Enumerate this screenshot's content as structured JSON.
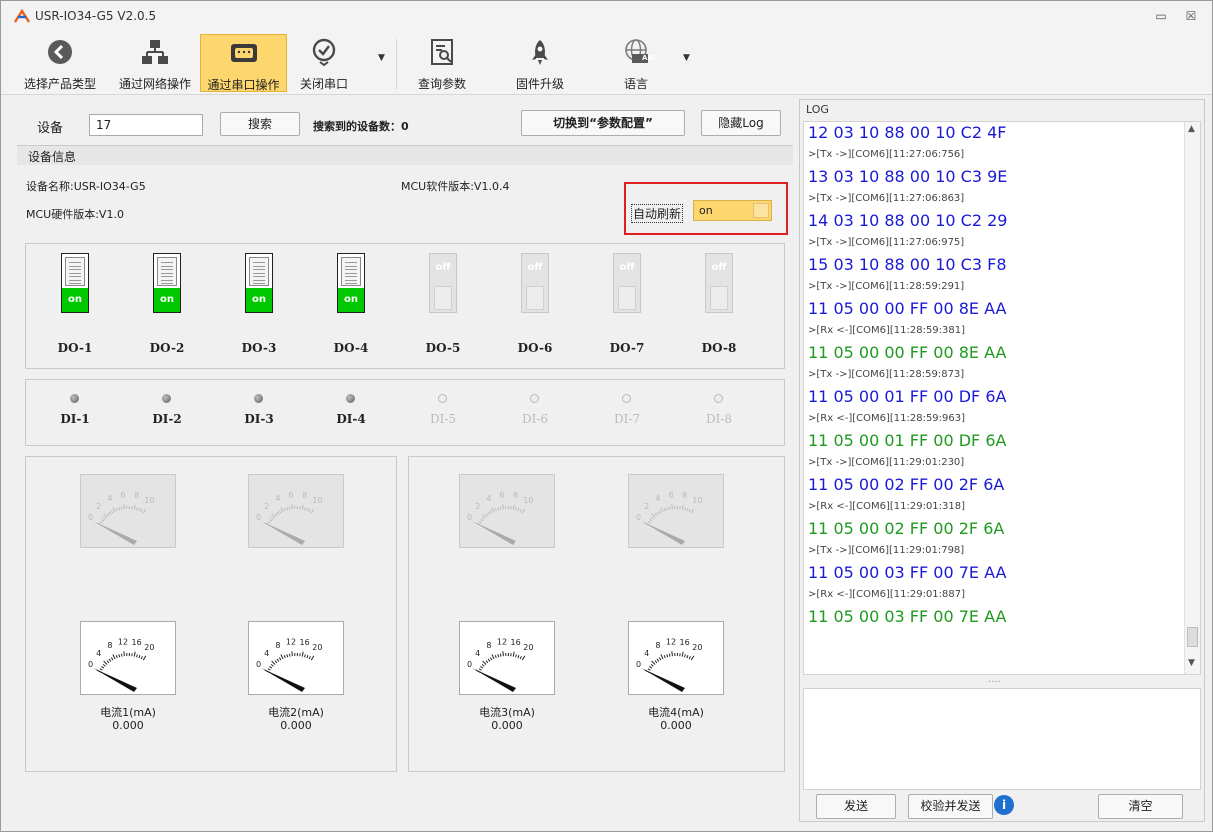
{
  "window": {
    "title": "USR-IO34-G5 V2.0.5",
    "minimize": "▭",
    "close": "☒"
  },
  "toolbar": {
    "items": [
      {
        "label": "选择产品类型"
      },
      {
        "label": "通过网络操作"
      },
      {
        "label": "通过串口操作"
      },
      {
        "label": "关闭串口"
      },
      {
        "label": "查询参数"
      },
      {
        "label": "固件升级"
      },
      {
        "label": "语言"
      }
    ],
    "lang_badge": "ABC"
  },
  "search": {
    "device_label": "设备",
    "device_value": "17",
    "search_button": "搜索",
    "found_text": "搜索到的设备数：0",
    "switch_button": "切换到“参数配置”",
    "hide_log_button": "隐藏Log"
  },
  "device_info": {
    "group_title": "设备信息",
    "device_name": "设备名称:USR-IO34-G5",
    "mcu_sw": "MCU软件版本:V1.0.4",
    "mcu_hw": "MCU硬件版本:V1.0",
    "auto_refresh_label": "自动刷新",
    "auto_refresh_value": "on"
  },
  "do": [
    {
      "label": "DO-1",
      "state": "on"
    },
    {
      "label": "DO-2",
      "state": "on"
    },
    {
      "label": "DO-3",
      "state": "on"
    },
    {
      "label": "DO-4",
      "state": "on"
    },
    {
      "label": "DO-5",
      "state": "off"
    },
    {
      "label": "DO-6",
      "state": "off"
    },
    {
      "label": "DO-7",
      "state": "off"
    },
    {
      "label": "DO-8",
      "state": "off"
    }
  ],
  "di": [
    {
      "label": "DI-1",
      "active": true
    },
    {
      "label": "DI-2",
      "active": true
    },
    {
      "label": "DI-3",
      "active": true
    },
    {
      "label": "DI-4",
      "active": true
    },
    {
      "label": "DI-5",
      "active": false
    },
    {
      "label": "DI-6",
      "active": false
    },
    {
      "label": "DI-7",
      "active": false
    },
    {
      "label": "DI-8",
      "active": false
    }
  ],
  "gauges_top": {
    "ticks": [
      "0",
      "2",
      "4",
      "6",
      "8",
      "10"
    ]
  },
  "gauges_current": {
    "ticks": [
      "0",
      "4",
      "8",
      "12",
      "16",
      "20"
    ],
    "items": [
      {
        "name": "电流1(mA)",
        "value": "0.000"
      },
      {
        "name": "电流2(mA)",
        "value": "0.000"
      },
      {
        "name": "电流3(mA)",
        "value": "0.000"
      },
      {
        "name": "电流4(mA)",
        "value": "0.000"
      }
    ]
  },
  "log": {
    "title": "LOG",
    "lines": [
      {
        "text": "12 03 10 88 00 10 C2 4F",
        "kind": "tx"
      },
      {
        "text": ">[Tx ->][COM6][11:27:06:756]",
        "kind": "meta"
      },
      {
        "text": "13 03 10 88 00 10 C3 9E",
        "kind": "tx"
      },
      {
        "text": ">[Tx ->][COM6][11:27:06:863]",
        "kind": "meta"
      },
      {
        "text": "14 03 10 88 00 10 C2 29",
        "kind": "tx"
      },
      {
        "text": ">[Tx ->][COM6][11:27:06:975]",
        "kind": "meta"
      },
      {
        "text": "15 03 10 88 00 10 C3 F8",
        "kind": "tx"
      },
      {
        "text": ">[Tx ->][COM6][11:28:59:291]",
        "kind": "meta"
      },
      {
        "text": "11 05 00 00 FF 00 8E AA",
        "kind": "tx"
      },
      {
        "text": ">[Rx <-][COM6][11:28:59:381]",
        "kind": "meta"
      },
      {
        "text": "11 05 00 00 FF 00 8E AA",
        "kind": "rx"
      },
      {
        "text": ">[Tx ->][COM6][11:28:59:873]",
        "kind": "meta"
      },
      {
        "text": "11 05 00 01 FF 00 DF 6A",
        "kind": "tx"
      },
      {
        "text": ">[Rx <-][COM6][11:28:59:963]",
        "kind": "meta"
      },
      {
        "text": "11 05 00 01 FF 00 DF 6A",
        "kind": "rx"
      },
      {
        "text": ">[Tx ->][COM6][11:29:01:230]",
        "kind": "meta"
      },
      {
        "text": "11 05 00 02 FF 00 2F 6A",
        "kind": "tx"
      },
      {
        "text": ">[Rx <-][COM6][11:29:01:318]",
        "kind": "meta"
      },
      {
        "text": "11 05 00 02 FF 00 2F 6A",
        "kind": "rx"
      },
      {
        "text": ">[Tx ->][COM6][11:29:01:798]",
        "kind": "meta"
      },
      {
        "text": "11 05 00 03 FF 00 7E AA",
        "kind": "tx"
      },
      {
        "text": ">[Rx <-][COM6][11:29:01:887]",
        "kind": "meta"
      },
      {
        "text": "11 05 00 03 FF 00 7E AA",
        "kind": "rx"
      }
    ],
    "splitter": "....",
    "send_button": "发送",
    "verify_send_button": "校验并发送",
    "clear_button": "清空"
  },
  "colors": {
    "tx": "#1a1ad6",
    "rx": "#1e9a1e",
    "accent": "#fdd66e",
    "highlight_border": "#e02020",
    "switch_on": "#00c800"
  }
}
